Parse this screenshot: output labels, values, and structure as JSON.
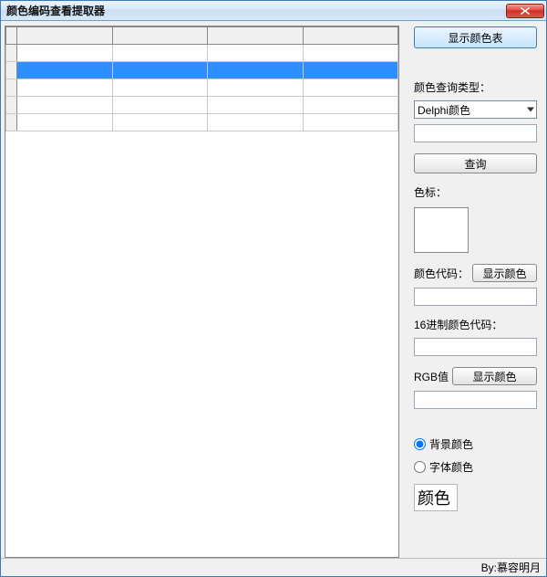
{
  "window": {
    "title": "颜色编码查看提取器"
  },
  "grid": {
    "columns": 5,
    "rows": 5,
    "selected_row": 1
  },
  "sidebar": {
    "show_table_btn": "显示颜色表",
    "query_type_label": "颜色查询类型：",
    "query_type_value": "Delphi颜色",
    "query_btn": "查询",
    "swatch_label": "色标：",
    "color_code_label": "颜色代码：",
    "show_color_btn1": "显示颜色",
    "hex_label": "16进制颜色代码：",
    "rgb_label": "RGB值",
    "show_color_btn2": "显示颜色",
    "radio_bg": "背景颜色",
    "radio_font": "字体颜色",
    "radio_selected": "bg",
    "sample_text": "颜色"
  },
  "status": {
    "author": "By:慕容明月"
  }
}
